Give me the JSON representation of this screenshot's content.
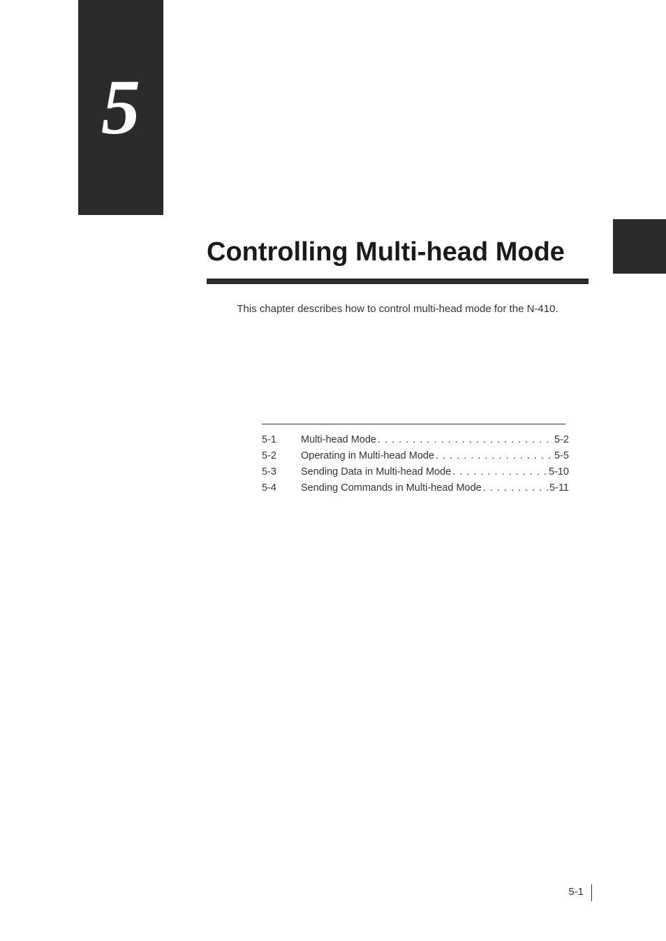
{
  "chapter": {
    "number": "5",
    "title": "Controlling Multi-head Mode",
    "description": "This chapter describes how to control multi-head mode for the N-410."
  },
  "toc": [
    {
      "section": "5-1",
      "title": "Multi-head Mode",
      "page": "5-2"
    },
    {
      "section": "5-2",
      "title": "Operating in Multi-head Mode",
      "page": "5-5"
    },
    {
      "section": "5-3",
      "title": "Sending Data in Multi-head Mode",
      "page": "5-10"
    },
    {
      "section": "5-4",
      "title": "Sending Commands in Multi-head Mode",
      "page": "5-11"
    }
  ],
  "footer": {
    "page_number": "5-1"
  }
}
